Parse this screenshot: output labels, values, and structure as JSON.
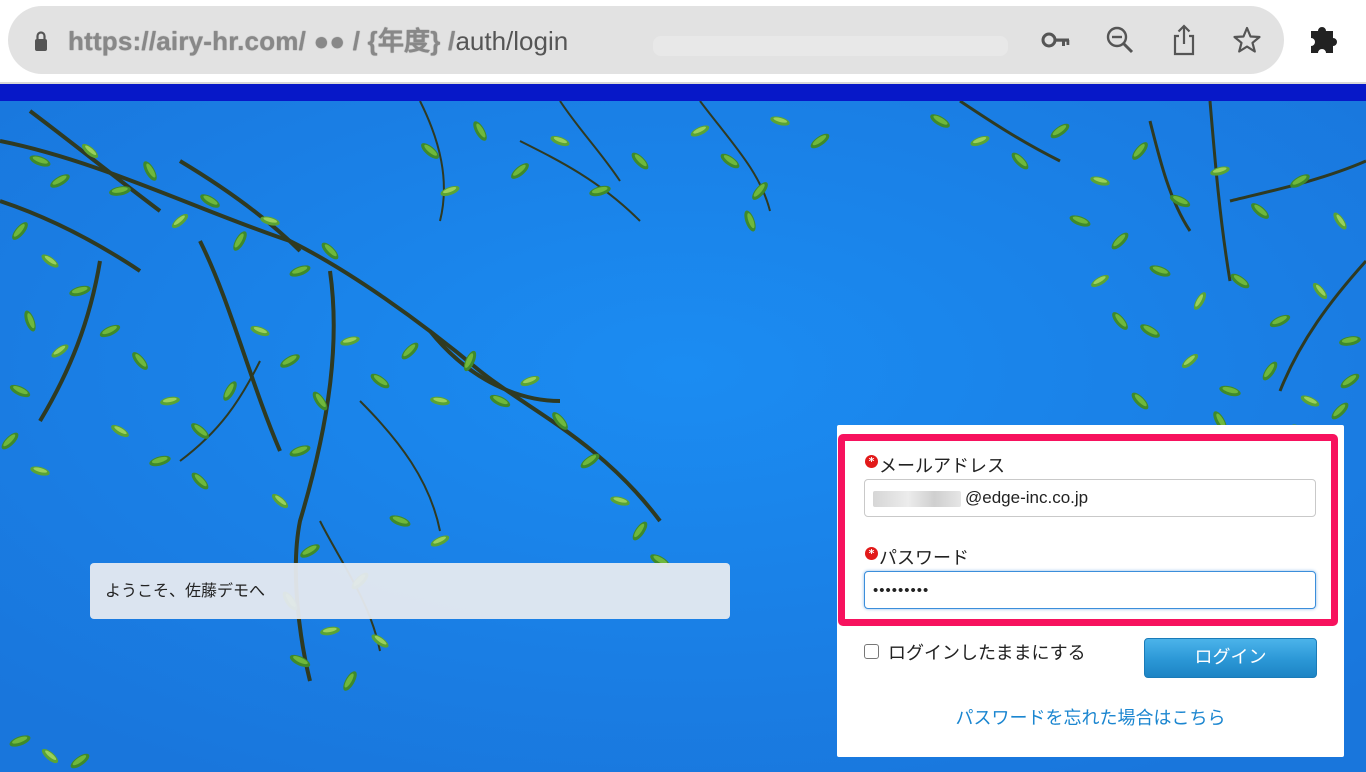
{
  "browser": {
    "url_host": "https://airy-hr.com/ ●● / {年度} /",
    "url_path": "auth/login",
    "icons": [
      "lock-icon",
      "key-icon",
      "zoom-out-icon",
      "share-icon",
      "bookmark-star-icon",
      "extensions-puzzle-icon"
    ]
  },
  "welcome": {
    "text": "ようこそ、佐藤デモへ"
  },
  "login": {
    "email_label": "メールアドレス",
    "email_value": "@edge-inc.co.jp",
    "password_label": "パスワード",
    "password_value": "•••••••••",
    "required_mark": "*",
    "remember_label": "ログインしたままにする",
    "remember_checked": false,
    "submit_label": "ログイン",
    "forgot_link": "パスワードを忘れた場合はこちら"
  },
  "colors": {
    "highlight": "#f7125e",
    "accent_blue": "#2b97d6",
    "link": "#1b86d0",
    "header_band": "#0718c8"
  }
}
